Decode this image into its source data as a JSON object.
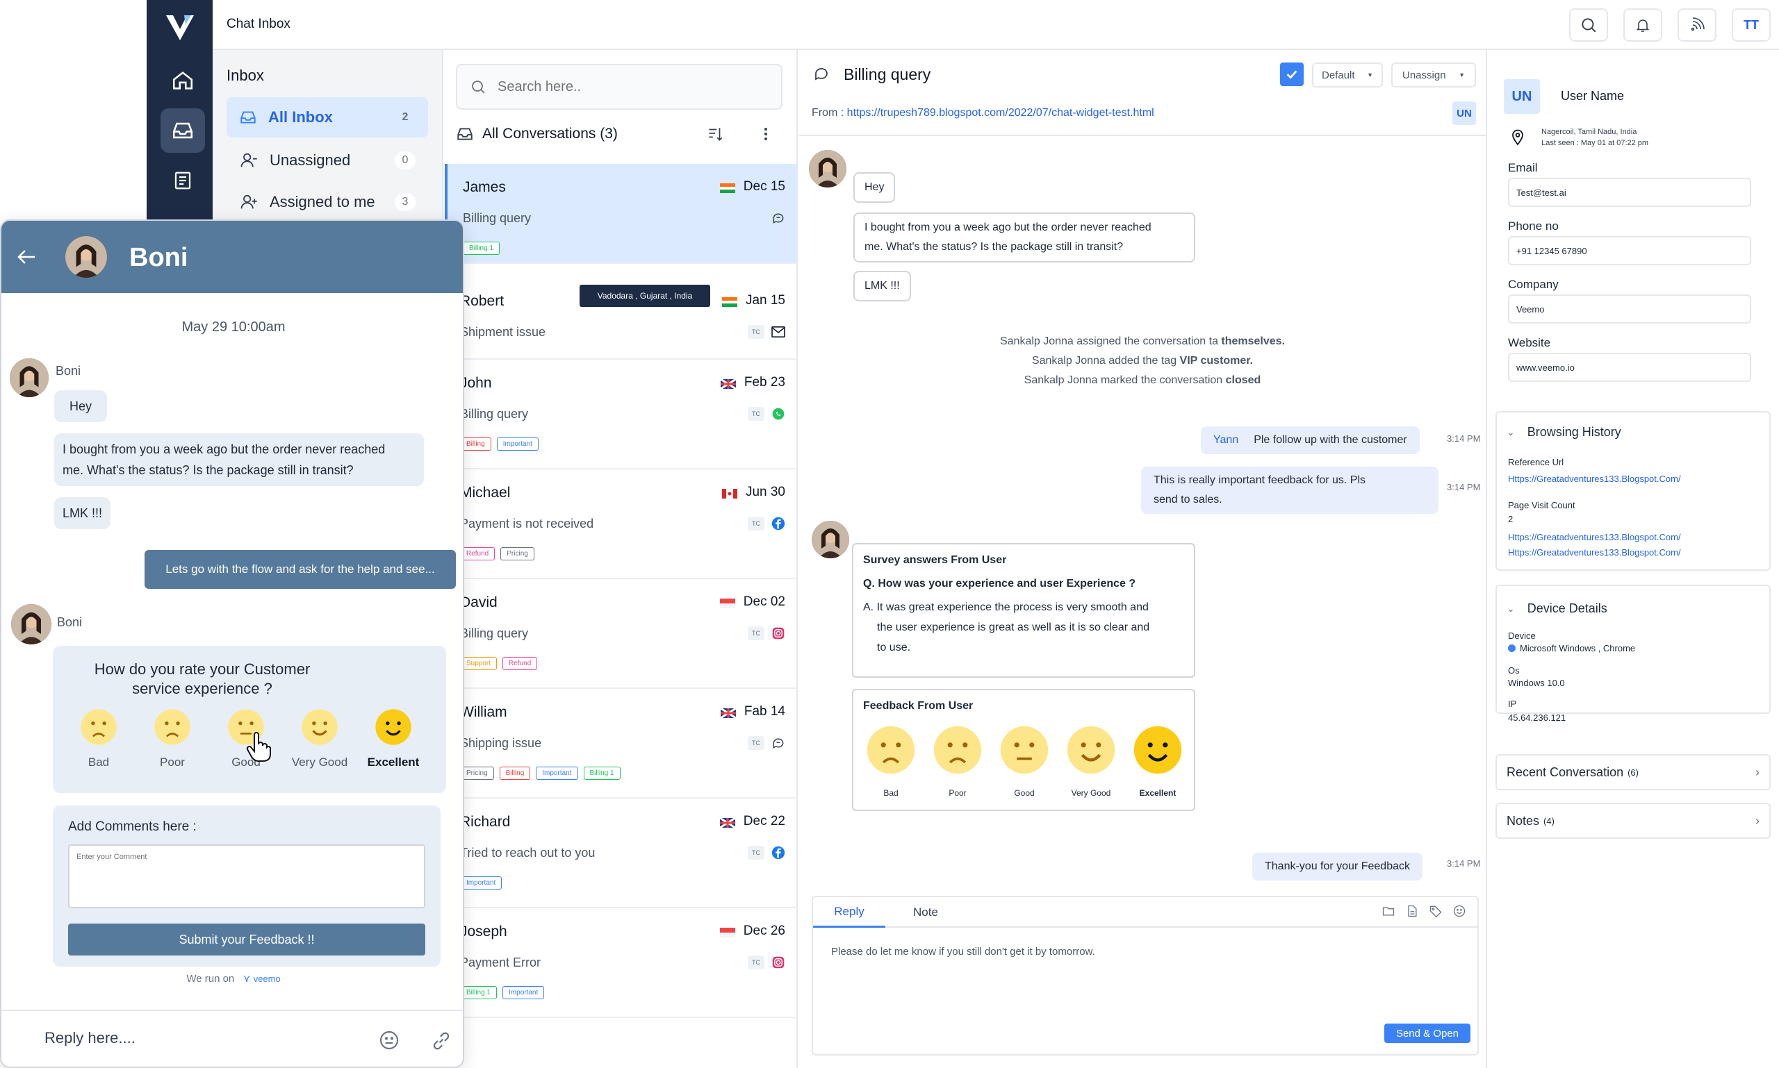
{
  "app": {
    "title": "Chat Inbox",
    "user_initials": "TT"
  },
  "inbox": {
    "heading": "Inbox",
    "items": [
      {
        "label": "All Inbox",
        "count": "2"
      },
      {
        "label": "Unassigned",
        "count": "0"
      },
      {
        "label": "Assigned to me",
        "count": "3"
      }
    ]
  },
  "conversations": {
    "search_placeholder": "Search here..",
    "header": "All Conversations (3)",
    "tooltip": "Vadodara , Gujarat , India",
    "tc_label": "TC",
    "items": [
      {
        "name": "James",
        "subject": "Billing query",
        "date": "Dec 15",
        "tags": [
          "Billing 1"
        ]
      },
      {
        "name": "Robert",
        "subject": "Shipment issue",
        "date": "Jan 15",
        "tags": []
      },
      {
        "name": "John",
        "subject": "Billing query",
        "date": "Feb 23",
        "tags": [
          "Billing",
          "Important"
        ]
      },
      {
        "name": "Michael",
        "subject": "Payment is not received",
        "date": "Jun 30",
        "tags": [
          "Refund",
          "Pricing"
        ]
      },
      {
        "name": "David",
        "subject": "Billing query",
        "date": "Dec 02",
        "tags": [
          "Support",
          "Refund"
        ]
      },
      {
        "name": "William",
        "subject": "Shipping issue",
        "date": "Fab 14",
        "tags": [
          "Pricing",
          "Billing",
          "Important",
          "Billing 1"
        ]
      },
      {
        "name": "Richard",
        "subject": "Tried to reach out to you",
        "date": "Dec 22",
        "tags": [
          "Important"
        ]
      },
      {
        "name": "Joseph",
        "subject": "Payment Error",
        "date": "Dec 26",
        "tags": [
          "Billing 1",
          "Important"
        ]
      }
    ]
  },
  "chat": {
    "title": "Billing query",
    "default_label": "Default",
    "unassign_label": "Unassign",
    "from_label": "From :",
    "from_url": "https://trupesh789.blogspot.com/2022/07/chat-widget-test.html",
    "un_badge": "UN",
    "messages": {
      "hey": "Hey",
      "order_line1": "I bought from you a week ago but the order never reached",
      "order_line2": "me. What's the status? Is the package still in transit?",
      "lmk": "LMK !!!"
    },
    "activity": {
      "l1_pre": "Sankalp Jonna assigned the conversation ta ",
      "l1_bold": "themselves.",
      "l2_pre": "Sankalp Jonna added the tag ",
      "l2_bold": "VIP customer.",
      "l3_pre": "Sankalp Jonna marked the conversation ",
      "l3_bold": "closed"
    },
    "out1_name": "Yann",
    "out1_text": "Ple follow up with the customer",
    "out1_time": "3:14 PM",
    "out2_line1": "This is really important feedback for us. Pls",
    "out2_line2": "send to sales.",
    "out2_time": "3:14 PM",
    "survey": {
      "title": "Survey answers From User",
      "question": "Q. How was your experience and user Experience ?",
      "answer_l1": "A. It was great experience the process is very smooth and",
      "answer_l2": "the user experience is great as well as it is so clear and",
      "answer_l3": "to use."
    },
    "feedback": {
      "title": "Feedback From User",
      "options": [
        "Bad",
        "Poor",
        "Good",
        "Very Good",
        "Excellent"
      ]
    },
    "out3_text": "Thank-you for your Feedback",
    "out3_time": "3:14 PM",
    "reply_tab": "Reply",
    "note_tab": "Note",
    "reply_text": "Please do let me know if you still don't get it by tomorrow.",
    "send_label": "Send & Open"
  },
  "contact": {
    "badge": "UN",
    "name": "User Name",
    "location": "Nagercoil, Tamil Nadu, India",
    "last_seen": "Last seen : May 01 at 07:22 pm",
    "email_label": "Email",
    "email": "Test@test.ai",
    "phone_label": "Phone no",
    "phone": "+91 12345 67890",
    "company_label": "Company",
    "company": "Veemo",
    "website_label": "Website",
    "website": "www.veemo.io",
    "browsing": {
      "title": "Browsing History",
      "ref_label": "Reference Url",
      "ref_url": "Https://Greatadventures133.Blogspot.Com/",
      "count_label": "Page Visit Count",
      "count": "2",
      "url1": "Https://Greatadventures133.Blogspot.Com/",
      "url2": "Https://Greatadventures133.Blogspot.Com/"
    },
    "device": {
      "title": "Device Details",
      "device_label": "Device",
      "device": "Microsoft Windows , Chrome",
      "os_label": "Os",
      "os": "Windows 10.0",
      "ip_label": "IP",
      "ip": "45.64.236.121"
    },
    "recent_label": "Recent Conversation",
    "recent_count": "(6)",
    "notes_label": "Notes",
    "notes_count": "(4)"
  },
  "widget": {
    "name": "Boni",
    "date": "May 29 10:00am",
    "sender": "Boni",
    "hey": "Hey",
    "order_line1": "I bought from you a week ago but the order never reached",
    "order_line2": "me. What's the status? Is the package still in transit?",
    "lmk": "LMK !!!",
    "outgoing": "Lets go with the flow and ask for the help and see...",
    "sender2": "Boni",
    "rate_l1": "How do you rate your Customer",
    "rate_l2": "service experience ?",
    "options": [
      "Bad",
      "Poor",
      "Good",
      "Very Good",
      "Excellent"
    ],
    "comments_label": "Add Comments here :",
    "comment_placeholder": "Enter your Comment",
    "submit": "Submit your Feedback !!",
    "run_on": "We run on",
    "brand": "veemo",
    "reply_placeholder": "Reply here...."
  },
  "colors": {
    "navy": "#1d2b45",
    "accent": "#2563eb",
    "widget_header": "#567a9b",
    "emoji": "#facc15"
  }
}
